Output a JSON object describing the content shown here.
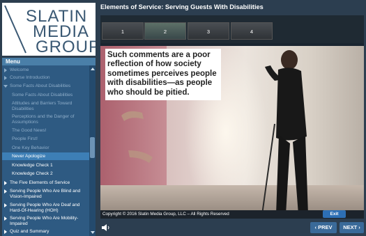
{
  "logo": {
    "line1": "SLATIN",
    "line2": "MEDIA",
    "line3": "GROUP"
  },
  "menu": {
    "tab_label": "Menu",
    "items": [
      {
        "label": "Welcome",
        "level": "top",
        "state": "dim"
      },
      {
        "label": "Course Introduction",
        "level": "top",
        "state": "dim"
      },
      {
        "label": "Some Facts About Disabilities",
        "level": "top",
        "state": "dim",
        "expanded": true
      },
      {
        "label": "Some Facts About Disabilities",
        "level": "sub",
        "state": "dim"
      },
      {
        "label": "Attitudes and Barriers Toward Disabilities",
        "level": "sub",
        "state": "dim"
      },
      {
        "label": "Perceptions and the Danger of Assumptions",
        "level": "sub",
        "state": "dim"
      },
      {
        "label": "The Good News!",
        "level": "sub",
        "state": "dim"
      },
      {
        "label": "People First!",
        "level": "sub",
        "state": "dim"
      },
      {
        "label": "One Key Behavior",
        "level": "sub",
        "state": "dim"
      },
      {
        "label": "Never Apologize",
        "level": "sub",
        "state": "selected"
      },
      {
        "label": "Knowledge Check 1",
        "level": "sub",
        "state": "bright"
      },
      {
        "label": "Knowledge Check 2",
        "level": "sub",
        "state": "bright"
      },
      {
        "label": "The Five Elements of Service",
        "level": "top",
        "state": "bright"
      },
      {
        "label": "Serving People Who Are Blind and Vision-Impaired",
        "level": "top",
        "state": "bright"
      },
      {
        "label": "Serving People Who Are Deaf and Hard-Of-Hearing (HOH)",
        "level": "top",
        "state": "bright"
      },
      {
        "label": "Serving People Who Are Mobility-Impaired",
        "level": "top",
        "state": "bright"
      },
      {
        "label": "Quiz and Summary",
        "level": "top",
        "state": "bright"
      }
    ]
  },
  "header": {
    "title": "Elements of Service: Serving Guests With Disabilities"
  },
  "tabs": [
    {
      "label": "1",
      "active": false
    },
    {
      "label": "2",
      "active": true
    },
    {
      "label": "3",
      "active": false
    },
    {
      "label": "4",
      "active": false
    }
  ],
  "caption": "Such comments are a poor reflection of how society sometimes perceives people with disabilities—as people who should be pitied.",
  "footer": {
    "copyright": "Copyright © 2016 Slatin Media Group, LLC – All Rights Reserved",
    "exit_label": "Exit"
  },
  "nav": {
    "prev_label": "‹ PREV",
    "next_label": "NEXT ›"
  },
  "icons": {
    "audio": "speaker-icon"
  },
  "colors": {
    "accent": "#2d6fb5",
    "menu_bg": "#2e5a82",
    "selected": "#3d7fb6"
  }
}
